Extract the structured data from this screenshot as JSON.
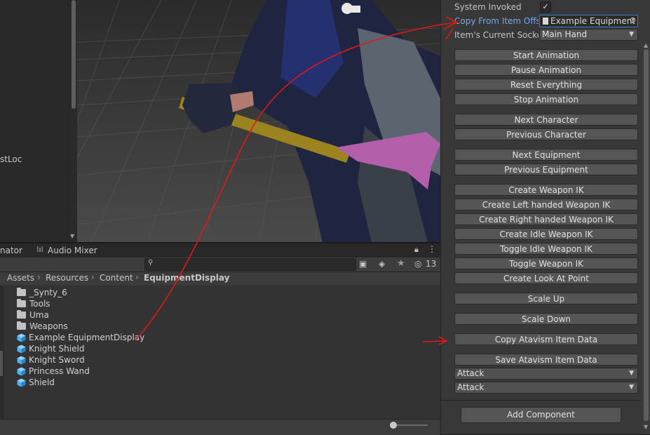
{
  "hierarchy": {
    "partial_text": "stLoc"
  },
  "tabs": [
    {
      "label": "nator"
    },
    {
      "label": "Audio Mixer"
    }
  ],
  "toolbar": {
    "search_value": "",
    "hidden_count": "13"
  },
  "breadcrumb": [
    "Assets",
    "Resources",
    "Content",
    "EquipmentDisplay"
  ],
  "files": [
    {
      "name": "_Synty_6",
      "type": "folder"
    },
    {
      "name": "Tools",
      "type": "folder"
    },
    {
      "name": "Uma",
      "type": "folder"
    },
    {
      "name": "Weapons",
      "type": "folder"
    },
    {
      "name": "Example EquipmentDisplay",
      "type": "prefab"
    },
    {
      "name": "Knight Shield",
      "type": "prefab"
    },
    {
      "name": "Knight Sword",
      "type": "prefab"
    },
    {
      "name": "Princess Wand",
      "type": "prefab"
    },
    {
      "name": "Shield",
      "type": "prefab"
    }
  ],
  "inspector": {
    "system_invoked_label": "System Invoked",
    "system_invoked_checked": true,
    "copy_from_label": "Copy From Item Offse",
    "copy_from_value": "Example Equipment",
    "current_socket_label": "Item's Current Socke",
    "current_socket_value": "Main Hand",
    "buttons": [
      "Start Animation",
      "Pause Animation",
      "Reset Everything",
      "Stop Animation",
      "Next Character",
      "Previous Character",
      "Next Equipment",
      "Previous Equipment",
      "Create Weapon IK",
      "Create Left handed Weapon IK",
      "Create Right handed Weapon IK",
      "Create Idle Weapon IK",
      "Toggle Idle Weapon IK",
      "Toggle Weapon IK",
      "Create Look At Point",
      "Scale Up",
      "Scale Down",
      "Copy Atavism Item Data",
      "Save Atavism Item Data"
    ],
    "dropdown_1": "Attack",
    "dropdown_2": "Attack",
    "add_component": "Add Component"
  },
  "colors": {
    "accent_link": "#7ba6ee",
    "annotation_red": "#e01818",
    "prefab_blue": "#4fb3ef"
  }
}
